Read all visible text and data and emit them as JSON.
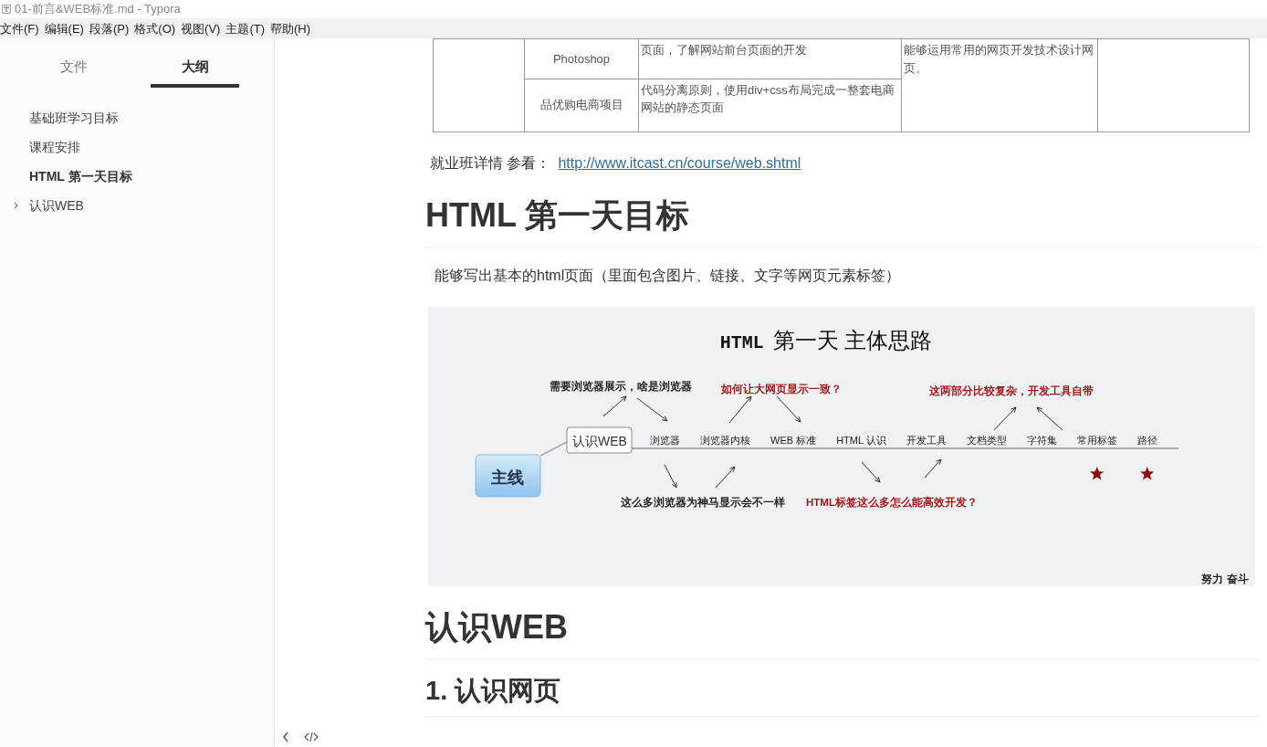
{
  "window": {
    "title": "01-前言&WEB标准.md - Typora"
  },
  "menu": [
    "文件(F)",
    "编辑(E)",
    "段落(P)",
    "格式(O)",
    "视图(V)",
    "主题(T)",
    "帮助(H)"
  ],
  "sidebar": {
    "tabs": [
      {
        "label": "文件",
        "selected": false
      },
      {
        "label": "大纲",
        "selected": true
      }
    ],
    "items": [
      {
        "label": "基础班学习目标",
        "kind": "leaf",
        "selected": false
      },
      {
        "label": "课程安排",
        "kind": "leaf",
        "selected": false
      },
      {
        "label": "HTML 第一天目标",
        "kind": "leaf",
        "selected": true
      },
      {
        "label": "认识WEB",
        "kind": "parent",
        "expanded": false,
        "selected": false
      }
    ]
  },
  "table": {
    "rows": [
      [
        "",
        "Photoshop",
        "页面，了解网站前台页面的开发",
        "能够运用常用的网页开发技术设计网页。",
        ""
      ],
      [
        "",
        "品优购电商项目",
        "代码分离原则，使用div+css布局完成一整套电商网站的静态页面",
        "",
        ""
      ]
    ]
  },
  "link_line": {
    "text": "就业班详情 参看：",
    "url": "http://www.itcast.cn/course/web.shtml"
  },
  "sections": [
    {
      "kind": "h1",
      "text": "HTML 第一天目标"
    },
    {
      "kind": "p",
      "text": "能够写出基本的html页面（里面包含图片、链接、文字等网页元素标签）"
    },
    {
      "kind": "mindmap"
    },
    {
      "kind": "h1",
      "text": "认识WEB"
    },
    {
      "kind": "h2",
      "text": "1. 认识网页"
    }
  ],
  "mindmap": {
    "title_code": "HTML",
    "title": "第一天 主体思路",
    "root": "主线",
    "topic": "认识WEB",
    "nodes": [
      {
        "label": "浏览器",
        "starred": false
      },
      {
        "label": "浏览器内核",
        "starred": false
      },
      {
        "label": "WEB 标准",
        "starred": false
      },
      {
        "label": "HTML 认识",
        "starred": false
      },
      {
        "label": "开发工具",
        "starred": false
      },
      {
        "label": "文档类型",
        "starred": false
      },
      {
        "label": "字符集",
        "starred": false
      },
      {
        "label": "常用标签",
        "starred": true
      },
      {
        "label": "路径",
        "starred": true
      }
    ],
    "notes": [
      {
        "text": "需要浏览器展示，啥是浏览器",
        "color": "#222222"
      },
      {
        "text": "如何让大网页显示一致？",
        "color": "#a01818"
      },
      {
        "text": "这两部分比较复杂，开发工具自带",
        "color": "#a01818"
      },
      {
        "text": "这么多浏览器为神马显示会不一样",
        "color": "#222222"
      },
      {
        "text": "HTML标签这么多怎么能高效开发？",
        "color": "#a01818"
      }
    ],
    "signature": "努力 奋斗"
  }
}
